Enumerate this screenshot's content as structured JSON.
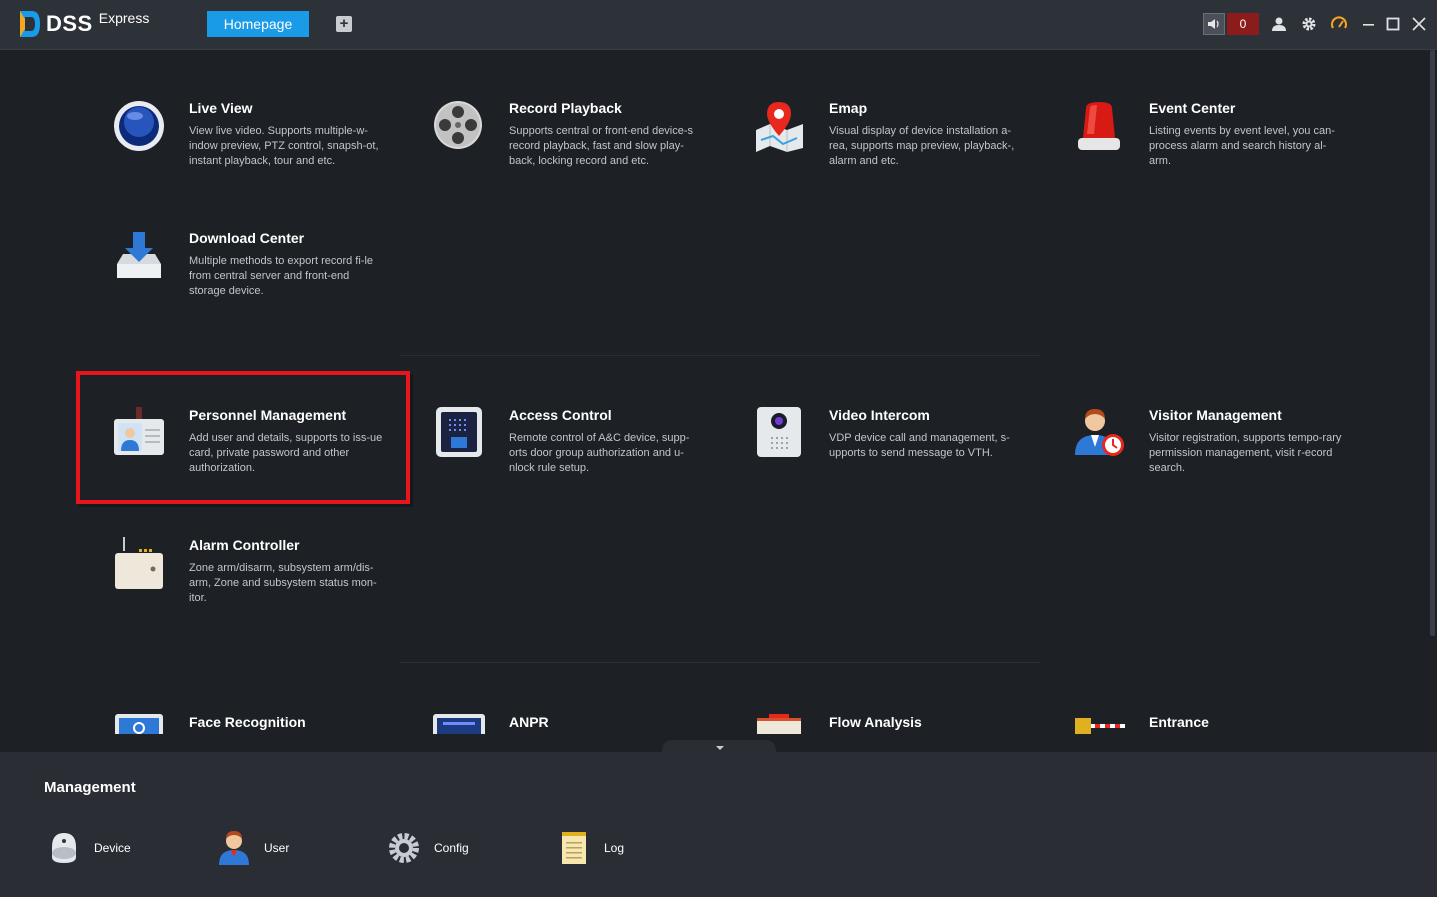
{
  "app": {
    "brand": "DSS",
    "brand_sub": "Express",
    "tab_home": "Homepage",
    "tab_add": "+",
    "alarm_count": "0"
  },
  "modules": [
    {
      "title": "Live View",
      "desc": "View live video. Supports multiple-w-indow preview, PTZ control, snapsh-ot, instant playback, tour and etc."
    },
    {
      "title": "Record Playback",
      "desc": "Supports central or front-end device-s record playback, fast and slow play-back, locking record and etc."
    },
    {
      "title": "Emap",
      "desc": "Visual display of device installation a-rea, supports map preview, playback-, alarm and etc."
    },
    {
      "title": "Event Center",
      "desc": "Listing events by event level, you can- process alarm and search history al-arm."
    },
    {
      "title": "Download Center",
      "desc": "Multiple methods to export record fi-le from central server and front-end storage device."
    },
    {
      "title": "Personnel Management",
      "desc": "Add user and details, supports to iss-ue card, private password and other authorization."
    },
    {
      "title": "Access Control",
      "desc": "Remote control of A&C device, supp-orts door group authorization and u-nlock rule setup."
    },
    {
      "title": "Video Intercom",
      "desc": "VDP device call and management, s-upports to send message to VTH."
    },
    {
      "title": "Visitor Management",
      "desc": "Visitor registration, supports tempo-rary permission management, visit r-ecord search."
    },
    {
      "title": "Alarm Controller",
      "desc": "Zone arm/disarm, subsystem arm/dis-arm, Zone and subsystem status mon-itor."
    },
    {
      "title": "Face Recognition",
      "desc": ""
    },
    {
      "title": "ANPR",
      "desc": ""
    },
    {
      "title": "Flow Analysis",
      "desc": ""
    },
    {
      "title": "Entrance",
      "desc": ""
    }
  ],
  "management": {
    "title": "Management",
    "items": [
      {
        "label": "Device"
      },
      {
        "label": "User"
      },
      {
        "label": "Config"
      },
      {
        "label": "Log"
      }
    ]
  },
  "colors": {
    "accent": "#1a9be8",
    "highlight": "#e8151b",
    "alarm": "#8c1c1c",
    "background": "#1d2126",
    "titlebar": "#2d3138"
  }
}
